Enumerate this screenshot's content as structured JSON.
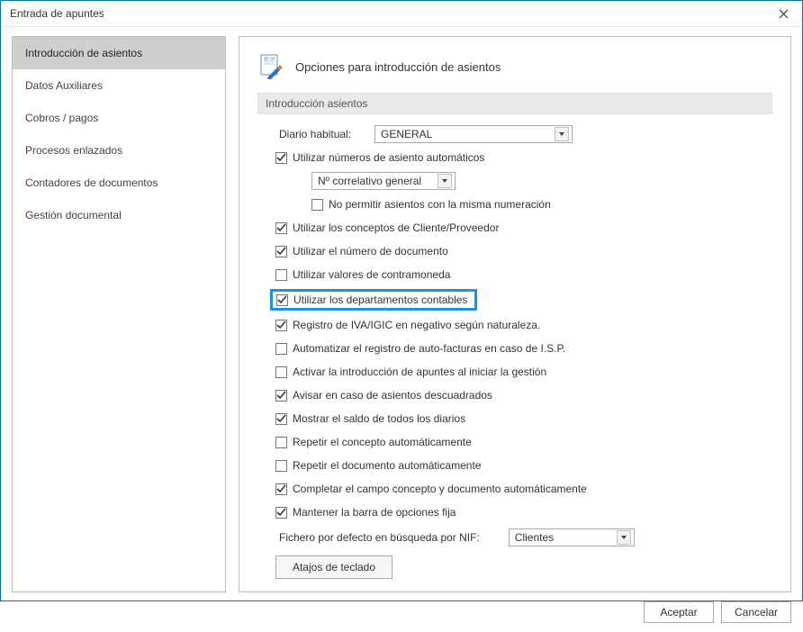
{
  "window": {
    "title": "Entrada de apuntes"
  },
  "sidebar": {
    "items": [
      {
        "label": "Introducción de asientos",
        "active": true
      },
      {
        "label": "Datos Auxiliares",
        "active": false
      },
      {
        "label": "Cobros / pagos",
        "active": false
      },
      {
        "label": "Procesos enlazados",
        "active": false
      },
      {
        "label": "Contadores de documentos",
        "active": false
      },
      {
        "label": "Gestión documental",
        "active": false
      }
    ]
  },
  "panel": {
    "title": "Opciones para introducción de asientos",
    "section_label": "Introducción asientos",
    "diario_label": "Diario habitual:",
    "diario_value": "GENERAL",
    "correlativo_value": "Nº correlativo general",
    "nif_label": "Fichero por defecto en búsqueda por NIF:",
    "nif_value": "Clientes",
    "atajos_label": "Atajos de teclado",
    "checkboxes": {
      "auto_numeros": {
        "label": "Utilizar números de asiento automáticos",
        "checked": true
      },
      "no_permitir": {
        "label": "No permitir asientos con la misma numeración",
        "checked": false
      },
      "conceptos_cp": {
        "label": "Utilizar los conceptos de Cliente/Proveedor",
        "checked": true
      },
      "num_doc": {
        "label": "Utilizar el número de documento",
        "checked": true
      },
      "contramoneda": {
        "label": "Utilizar valores de contramoneda",
        "checked": false
      },
      "departamentos": {
        "label": "Utilizar los departamentos contables",
        "checked": true
      },
      "iva_igic": {
        "label": "Registro de IVA/IGIC en negativo según naturaleza.",
        "checked": true
      },
      "autofacturas": {
        "label": "Automatizar el registro de auto-facturas en caso de I.S.P.",
        "checked": false
      },
      "activar_intro": {
        "label": "Activar la introducción de apuntes al iniciar la gestión",
        "checked": false
      },
      "avisar_desc": {
        "label": "Avisar en caso de asientos descuadrados",
        "checked": true
      },
      "mostrar_saldo": {
        "label": "Mostrar el saldo de todos los diarios",
        "checked": true
      },
      "repetir_concepto": {
        "label": "Repetir el concepto automáticamente",
        "checked": false
      },
      "repetir_doc": {
        "label": "Repetir el documento automáticamente",
        "checked": false
      },
      "completar_campo": {
        "label": "Completar el campo concepto y documento automáticamente",
        "checked": true
      },
      "mantener_barra": {
        "label": "Mantener la barra de opciones fija",
        "checked": true
      }
    }
  },
  "footer": {
    "accept": "Aceptar",
    "cancel": "Cancelar"
  }
}
